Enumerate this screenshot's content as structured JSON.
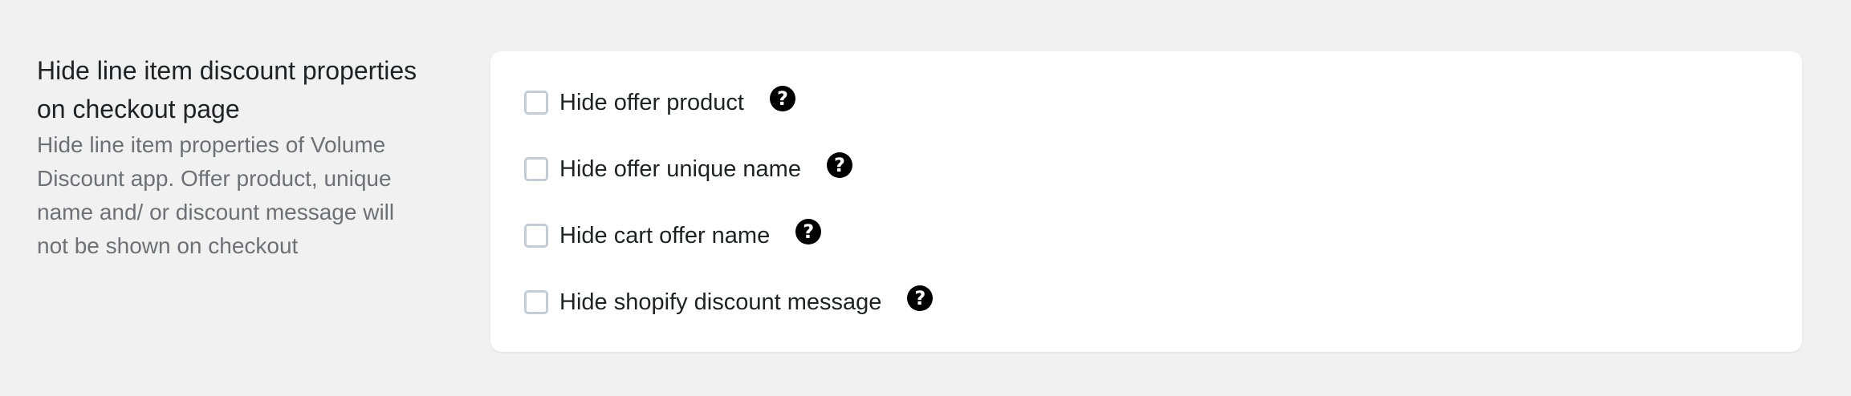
{
  "section": {
    "title_line1": "Hide line item discount properties",
    "title_line2": "on checkout page",
    "description_lines": [
      "Hide line item properties of Volume",
      "Discount app. Offer product, unique",
      "name and/ or discount message will",
      "not be shown on checkout"
    ]
  },
  "options": [
    {
      "label": "Hide offer product",
      "checked": false,
      "help_icon": "question-circle-icon",
      "help_glyph": "?"
    },
    {
      "label": "Hide offer unique name",
      "checked": false,
      "help_icon": "question-circle-icon",
      "help_glyph": "?"
    },
    {
      "label": "Hide cart offer name",
      "checked": false,
      "help_icon": "question-circle-icon",
      "help_glyph": "?"
    },
    {
      "label": "Hide shopify discount message",
      "checked": false,
      "help_icon": "question-circle-icon",
      "help_glyph": "?"
    }
  ],
  "colors": {
    "page_background": "#f1f1f1",
    "card_background": "#ffffff",
    "title_text": "#202223",
    "description_text": "#6d7175",
    "checkbox_border": "#c4cdd5",
    "help_icon": "#000000"
  }
}
